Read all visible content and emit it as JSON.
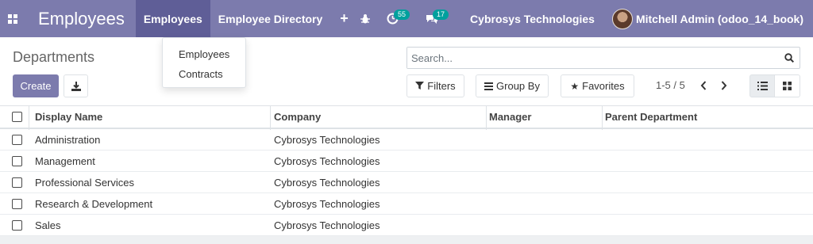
{
  "navbar": {
    "app_title": "Employees",
    "menu": [
      {
        "label": "Employees",
        "active": true
      },
      {
        "label": "Employee Directory",
        "active": false
      }
    ],
    "plus_label": "+",
    "activity_count": "55",
    "message_count": "17",
    "company": "Cybrosys Technologies",
    "user": "Mitchell Admin (odoo_14_book)"
  },
  "dropdown": {
    "items": [
      "Employees",
      "Contracts"
    ]
  },
  "control": {
    "title": "Departments",
    "create_label": "Create",
    "search_placeholder": "Search...",
    "filters_label": "Filters",
    "groupby_label": "Group By",
    "favorites_label": "Favorites",
    "pager": "1-5 / 5"
  },
  "table": {
    "headers": [
      "Display Name",
      "Company",
      "Manager",
      "Parent Department"
    ],
    "rows": [
      [
        "Administration",
        "Cybrosys Technologies",
        "",
        ""
      ],
      [
        "Management",
        "Cybrosys Technologies",
        "",
        ""
      ],
      [
        "Professional Services",
        "Cybrosys Technologies",
        "",
        ""
      ],
      [
        "Research & Development",
        "Cybrosys Technologies",
        "",
        ""
      ],
      [
        "Sales",
        "Cybrosys Technologies",
        "",
        ""
      ]
    ]
  },
  "colors": {
    "primary": "#7c7bad",
    "navbar_active": "#5f5e97",
    "badge": "#00a09d"
  }
}
